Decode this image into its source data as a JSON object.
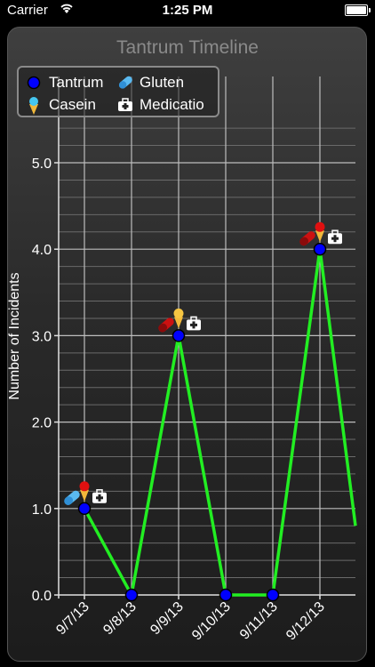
{
  "status_bar": {
    "carrier": "Carrier",
    "time": "1:25 PM"
  },
  "colors": {
    "line": "#22ee22",
    "marker": "#0000ff",
    "grid": "#bdbdbd",
    "gluten_icon": "#cc1111",
    "casein_cone": "#f2b93b",
    "casein_scoop_red": "#e01010",
    "casein_scoop_yellow": "#f5c542"
  },
  "legend": {
    "items": [
      {
        "label": "Tantrum",
        "icon": "blue-dot-icon"
      },
      {
        "label": "Gluten",
        "icon": "capsule-icon"
      },
      {
        "label": "Casein",
        "icon": "ice-cream-icon"
      },
      {
        "label": "Medicatio",
        "icon": "medical-kit-icon"
      }
    ]
  },
  "chart_data": {
    "type": "line",
    "title": "Tantrum Timeline",
    "ylabel": "Number of Incidents",
    "xlabel": "",
    "categories": [
      "9/7/13",
      "9/8/13",
      "9/9/13",
      "9/10/13",
      "9/11/13",
      "9/12/13"
    ],
    "ylim": [
      0,
      5.5
    ],
    "yticks": [
      "0.0",
      "1.0",
      "2.0",
      "3.0",
      "4.0",
      "5.0"
    ],
    "grid": true,
    "legend_position": "top-left",
    "series": [
      {
        "name": "Tantrum",
        "values": [
          1,
          0,
          3,
          0,
          0,
          4
        ]
      }
    ],
    "line_continues_to": 0.8,
    "annotations": [
      {
        "x": "9/7/13",
        "icons": [
          "capsule-icon",
          "ice-cream-icon",
          "medical-kit-icon"
        ],
        "scoop": "red"
      },
      {
        "x": "9/9/13",
        "icons": [
          "capsule-icon",
          "ice-cream-icon",
          "medical-kit-icon"
        ],
        "scoop": "yellow"
      },
      {
        "x": "9/12/13",
        "icons": [
          "capsule-icon",
          "ice-cream-icon",
          "medical-kit-icon"
        ],
        "scoop": "red"
      }
    ]
  }
}
